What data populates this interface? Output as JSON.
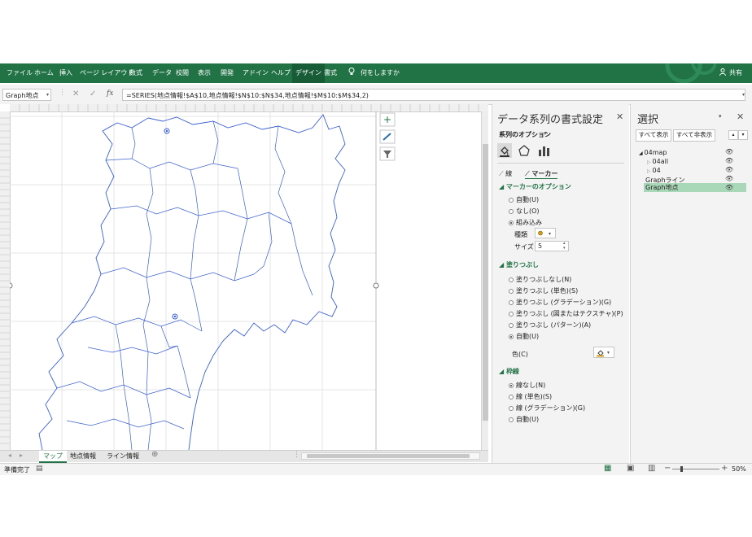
{
  "ribbon": {
    "tabs": [
      "ファイル",
      "ホーム",
      "挿入",
      "ページ レイアウト",
      "数式",
      "データ",
      "校閲",
      "表示",
      "開発",
      "アドイン",
      "ヘルプ",
      "デザイン",
      "書式"
    ],
    "tell_me": "何をしますか",
    "share": "共有"
  },
  "formula_bar": {
    "name_box": "Graph地点",
    "formula": "=SERIES(地点情報!$A$10,地点情報!$N$10:$N$34,地点情報!$M$10:$M$34,2)",
    "fx": "fx"
  },
  "sheet_tabs": [
    "マップ",
    "地点情報",
    "ライン情報"
  ],
  "status": {
    "ready": "準備完了",
    "zoom": "50%"
  },
  "format_pane": {
    "title": "データ系列の書式設定",
    "series_options": "系列のオプション",
    "line_tab": "線",
    "marker_tab": "マーカー",
    "marker_options_header": "マーカーのオプション",
    "marker_options": [
      {
        "label": "自動(U)",
        "selected": false
      },
      {
        "label": "なし(O)",
        "selected": false
      },
      {
        "label": "組み込み",
        "selected": true
      }
    ],
    "type_label": "種類",
    "size_label": "サイズ",
    "size_value": "5",
    "fill_header": "塗りつぶし",
    "fill_options": [
      {
        "label": "塗りつぶしなし(N)",
        "selected": false
      },
      {
        "label": "塗りつぶし (単色)(S)",
        "selected": false
      },
      {
        "label": "塗りつぶし (グラデーション)(G)",
        "selected": false
      },
      {
        "label": "塗りつぶし (図またはテクスチャ)(P)",
        "selected": false
      },
      {
        "label": "塗りつぶし (パターン)(A)",
        "selected": false
      },
      {
        "label": "自動(U)",
        "selected": true
      }
    ],
    "color_label": "色(C)",
    "border_header": "枠線",
    "border_options": [
      {
        "label": "線なし(N)",
        "selected": true
      },
      {
        "label": "線 (単色)(S)",
        "selected": false
      },
      {
        "label": "線 (グラデーション)(G)",
        "selected": false
      },
      {
        "label": "自動(U)",
        "selected": false
      }
    ]
  },
  "selection_pane": {
    "title": "選択",
    "show_all": "すべて表示",
    "hide_all": "すべて非表示",
    "items": [
      {
        "label": "04map",
        "indent": 0,
        "selected": false
      },
      {
        "label": "04all",
        "indent": 1,
        "selected": false
      },
      {
        "label": "04",
        "indent": 1,
        "selected": false
      },
      {
        "label": "Graphライン",
        "indent": 0,
        "selected": false
      },
      {
        "label": "Graph地点",
        "indent": 0,
        "selected": true
      }
    ]
  },
  "colors": {
    "excel_green": "#217346",
    "map_line": "#3a5fd0",
    "selected_item": "#a9d8b8"
  }
}
